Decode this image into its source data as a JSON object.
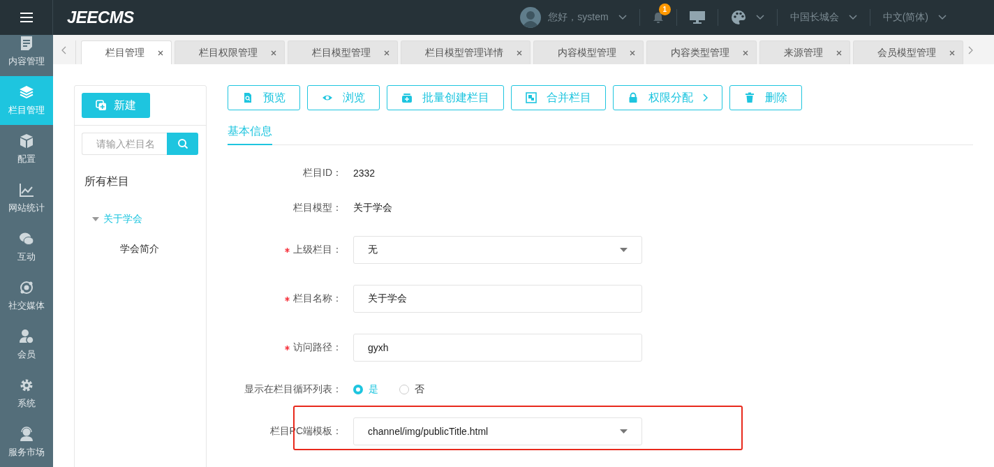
{
  "header": {
    "logo": "JEECMS",
    "user": "您好，system",
    "notification_count": "1",
    "site": "中国长城会",
    "language": "中文(简体)"
  },
  "sidebar": {
    "items": [
      {
        "label": "内容管理",
        "selected": false
      },
      {
        "label": "栏目管理",
        "selected": true
      },
      {
        "label": "配置",
        "selected": false
      },
      {
        "label": "网站统计",
        "selected": false
      },
      {
        "label": "互动",
        "selected": false
      },
      {
        "label": "社交媒体",
        "selected": false
      },
      {
        "label": "会员",
        "selected": false
      },
      {
        "label": "系统",
        "selected": false
      },
      {
        "label": "服务市场",
        "selected": false
      }
    ]
  },
  "tabs": [
    {
      "label": "栏目管理",
      "selected": true
    },
    {
      "label": "栏目权限管理",
      "selected": false
    },
    {
      "label": "栏目模型管理",
      "selected": false
    },
    {
      "label": "栏目模型管理详情",
      "selected": false
    },
    {
      "label": "内容模型管理",
      "selected": false
    },
    {
      "label": "内容类型管理",
      "selected": false
    },
    {
      "label": "来源管理",
      "selected": false
    },
    {
      "label": "会员模型管理",
      "selected": false
    }
  ],
  "left_panel": {
    "new_button": "新建",
    "search": {
      "placeholder": "请输入栏目名"
    },
    "tree_title": "所有栏目",
    "tree": [
      {
        "label": "关于学会",
        "selected": true,
        "expanded": true,
        "children": [
          {
            "label": "学会简介",
            "selected": false
          }
        ]
      }
    ]
  },
  "toolbar": [
    {
      "label": "预览",
      "kind": "button"
    },
    {
      "label": "浏览",
      "kind": "button"
    },
    {
      "label": "批量创建栏目",
      "kind": "button"
    },
    {
      "label": "合并栏目",
      "kind": "button"
    },
    {
      "label": "权限分配",
      "kind": "menu"
    },
    {
      "label": "删除",
      "kind": "button"
    }
  ],
  "section_tabs": [
    {
      "label": "基本信息",
      "selected": true
    }
  ],
  "form": [
    {
      "kind": "text",
      "label": "栏目ID：",
      "value": "2332",
      "required": false
    },
    {
      "kind": "text",
      "label": "栏目模型：",
      "value": "关于学会",
      "required": false
    },
    {
      "kind": "select",
      "label": "上级栏目：",
      "value": "无",
      "required": true
    },
    {
      "kind": "input",
      "label": "栏目名称：",
      "value": "关于学会",
      "required": true
    },
    {
      "kind": "input",
      "label": "访问路径：",
      "value": "gyxh",
      "required": true
    },
    {
      "kind": "radio",
      "label": "显示在栏目循环列表：",
      "required": false,
      "options": [
        {
          "label": "是",
          "selected": true
        },
        {
          "label": "否",
          "selected": false
        }
      ]
    },
    {
      "kind": "select",
      "label": "栏目PC端模板：",
      "value": "channel/img/publicTitle.html",
      "required": false,
      "highlighted": true
    }
  ]
}
